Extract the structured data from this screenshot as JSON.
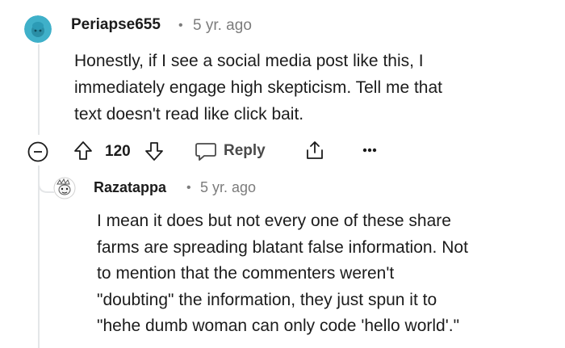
{
  "comment": {
    "username": "Periapse655",
    "separator": "•",
    "time": "5 yr. ago",
    "lines": [
      "Honestly, if I see a social media post like this, I",
      "immediately engage high skepticism. Tell me that",
      "text doesn't read like click bait."
    ],
    "votes": "120",
    "reply_label": "Reply"
  },
  "reply": {
    "username": "Razatappa",
    "separator": "•",
    "time": "5 yr. ago",
    "lines": [
      "I mean it does but not every one of these share",
      "farms are spreading blatant false information. Not",
      "to mention that the commenters weren't",
      "\"doubting\" the information, they just spun it to",
      "\"hehe dumb woman can only code 'hello world'.\""
    ]
  },
  "icons": {
    "collapse": "collapse-icon",
    "upvote": "upvote-icon",
    "downvote": "downvote-icon",
    "reply": "reply-icon",
    "share": "share-icon",
    "more": "more-icon"
  },
  "colors": {
    "avatar_teal": "#3fb0c9",
    "thread_line": "#e4e6e8",
    "meta_gray": "#7c7c7c"
  }
}
